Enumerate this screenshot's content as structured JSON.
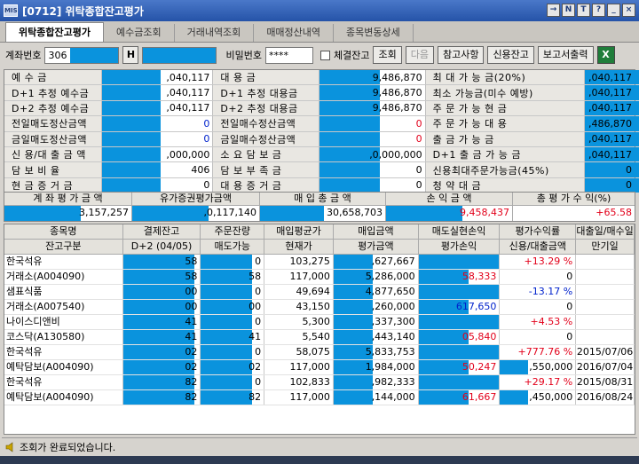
{
  "window": {
    "title": "[0712] 위탁종합잔고평가",
    "app_icon": "MIS",
    "buttons": [
      "→",
      "N",
      "T",
      "?",
      "_",
      "×"
    ]
  },
  "tabs": [
    "위탁종합잔고평가",
    "예수금조회",
    "거래내역조회",
    "매매정산내역",
    "종목변동상세"
  ],
  "toolbar": {
    "account_label": "계좌번호",
    "account_value": "306",
    "h_button": "H",
    "password_label": "비밀번호",
    "password_value": "****",
    "checkbox_label": "체결잔고",
    "buttons": {
      "query": "조회",
      "next": "다음",
      "reference": "참고사항",
      "credit": "신용잔고",
      "report": "보고서출력"
    }
  },
  "summary": [
    [
      "예 수 금",
      ",040,117",
      "대 용 금",
      "9,486,870",
      "최 대 가 능 금(20%)",
      ",040,117"
    ],
    [
      "D+1 추정 예수금",
      ",040,117",
      "D+1 추정 대용금",
      "9,486,870",
      "최소 가능금(미수 예방)",
      ",040,117"
    ],
    [
      "D+2 추정 예수금",
      ",040,117",
      "D+2 추정 대용금",
      "9,486,870",
      "주 문 가 능 현 금",
      ",040,117"
    ],
    [
      "전일매도정산금액",
      "0",
      "전일매수정산금액",
      "0",
      "주 문 가 능 대 용",
      ",486,870"
    ],
    [
      "금일매도정산금액",
      "0",
      "금일매수정산금액",
      "0",
      "출 금 가 능 금",
      ",040,117"
    ],
    [
      "신 용/대 출 금 액",
      ",000,000",
      "소 요 담 보 금",
      ",0,000,000",
      "D+1 출 금 가 능 금",
      ",040,117"
    ],
    [
      "담 보 비 율",
      "406",
      "담 보 부 족 금",
      "0",
      "신용최대주문가능금(45%)",
      "0"
    ],
    [
      "현 금 증 거 금",
      "0",
      "대 용 증 거 금",
      "0",
      "청 약 대 금",
      "0"
    ]
  ],
  "totals": {
    "headers": [
      "계 좌 평 가 금 액",
      "유가증권평가금액",
      "매 입 총 금 액",
      "손 익 금 액",
      "총 평 가 수 익(%)"
    ],
    "values": [
      "3,157,257",
      ",0,117,140",
      "30,658,703",
      "9,458,437",
      "+65.58"
    ]
  },
  "grid": {
    "headers_row1": [
      "종목명",
      "결제잔고",
      "주문잔량",
      "매입평균가",
      "매입금액",
      "매도실현손익",
      "평가수익률",
      "대출일/매수일"
    ],
    "headers_row2": [
      "잔고구분",
      "D+2 (04/05)",
      "매도가능",
      "현재가",
      "평가금액",
      "평가손익",
      "신용/대출금액",
      "만기일"
    ],
    "rows": [
      [
        "한국석유",
        "58",
        "0",
        "103,275",
        ",627,667",
        "",
        "+13.29 %",
        ""
      ],
      [
        "거래소(A004090)",
        "58",
        "58",
        "117,000",
        "5,286,000",
        "58,333",
        "0",
        ""
      ],
      [
        "샘표식품",
        "00",
        "0",
        "49,694",
        "4,877,650",
        "",
        "-13.17 %",
        ""
      ],
      [
        "거래소(A007540)",
        "00",
        "00",
        "43,150",
        ",260,000",
        "617,650",
        "0",
        ""
      ],
      [
        "나이스디앤비",
        "41",
        "0",
        "5,300",
        ",337,300",
        "",
        "+4.53 %",
        ""
      ],
      [
        "코스닥(A130580)",
        "41",
        "41",
        "5,540",
        ",443,140",
        "05,840",
        "0",
        ""
      ],
      [
        "한국석유",
        "02",
        "0",
        "58,075",
        "5,833,753",
        "",
        "+777.76 %",
        "2015/07/06"
      ],
      [
        "예탁담보(A004090)",
        "02",
        "02",
        "117,000",
        "1,984,000",
        "50,247",
        ",550,000",
        "2016/07/04"
      ],
      [
        "한국석유",
        "82",
        "0",
        "102,833",
        ",982,333",
        "",
        "+29.17 %",
        "2015/08/31"
      ],
      [
        "예탁담보(A004090)",
        "82",
        "82",
        "117,000",
        ",144,000",
        "61,667",
        ",450,000",
        "2016/08/24"
      ]
    ]
  },
  "status": {
    "message": "조회가 완료되었습니다."
  },
  "colors": {
    "mask": "#0a93dd",
    "title_bar": "#2f5fb5",
    "positive": "#e2001a",
    "negative": "#0022cc"
  }
}
